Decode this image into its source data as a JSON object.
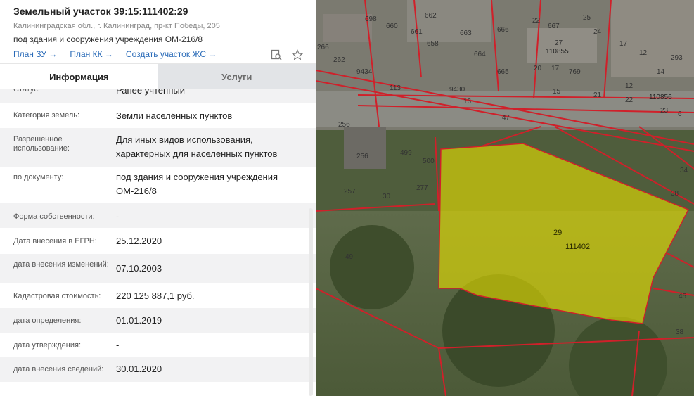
{
  "parcel": {
    "title": "Земельный участок 39:15:111402:29",
    "address": "Калининградская обл., г. Калининград, пр-кт Победы, 205",
    "purpose": "под здания и сооружения учреждения ОМ-216/8"
  },
  "links": {
    "plan_zu": "План ЗУ →",
    "plan_kk": "План КК →",
    "create": "Создать участок ЖС →"
  },
  "icons": {
    "search": "search-document-icon",
    "favorite": "star-icon"
  },
  "tabs": {
    "info": "Информация",
    "services": "Услуги"
  },
  "rows": [
    {
      "label": "Статус:",
      "value": "Ранее учтенный"
    },
    {
      "label": "Категория земель:",
      "value": "Земли населённых пунктов"
    },
    {
      "label": "Разрешенное использование:",
      "value": "Для иных видов использования, характерных для населенных пунктов"
    },
    {
      "label": "по документу:",
      "value": "под здания и сооружения учреждения ОМ-216/8"
    },
    {
      "label": "Форма собственности:",
      "value": "-"
    },
    {
      "label": "Дата внесения в ЕГРН:",
      "value": "25.12.2020"
    },
    {
      "label": "дата внесения изменений:",
      "value": "07.10.2003"
    },
    {
      "label": "Кадастровая стоимость:",
      "value": "220 125 887,1 руб."
    },
    {
      "label": "дата определения:",
      "value": "01.01.2019"
    },
    {
      "label": "дата утверждения:",
      "value": "-"
    },
    {
      "label": "дата внесения сведений:",
      "value": "30.01.2020"
    }
  ],
  "map": {
    "parcel_number": "29",
    "quarter_number": "111402",
    "labels": [
      "698",
      "660",
      "661",
      "662",
      "663",
      "664",
      "665",
      "666",
      "658",
      "266",
      "262",
      "9434",
      "113",
      "9430",
      "16",
      "47",
      "17",
      "667",
      "25",
      "22",
      "110855",
      "27",
      "20",
      "769",
      "15",
      "21",
      "12",
      "22",
      "110856",
      "23",
      "6",
      "256",
      "256",
      "257",
      "30",
      "499",
      "500",
      "277",
      "34",
      "38",
      "49",
      "45",
      "38",
      "293",
      "17",
      "24",
      "12",
      "14"
    ]
  },
  "colors": {
    "parcel_fill": "#e6e000",
    "boundary": "#d0202a",
    "link": "#2a6bb8"
  }
}
